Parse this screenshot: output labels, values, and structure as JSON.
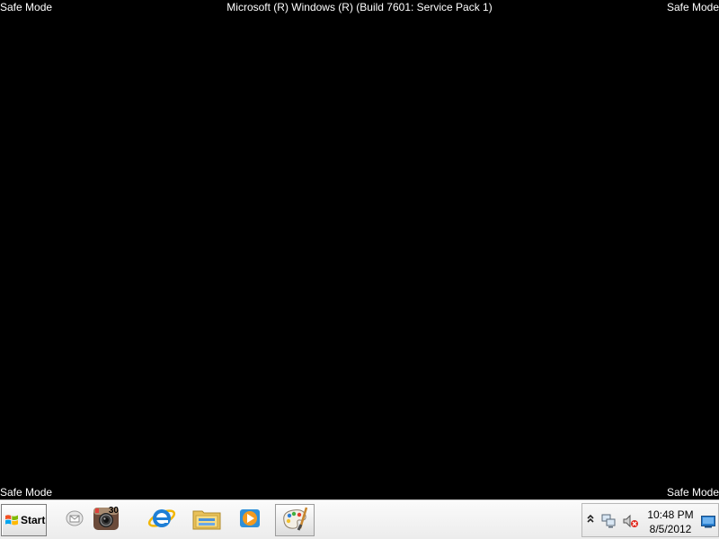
{
  "screen": {
    "mode_label": "Safe Mode",
    "os_banner": "Microsoft (R) Windows (R) (Build 7601: Service Pack 1)"
  },
  "taskbar": {
    "start_label": "Start",
    "pinned": [
      {
        "icon": "mail-icon"
      },
      {
        "icon": "camera-app-icon",
        "badge": "30"
      },
      {
        "icon": "internet-explorer-icon"
      },
      {
        "icon": "windows-explorer-icon"
      },
      {
        "icon": "media-player-icon"
      },
      {
        "icon": "paint-icon"
      }
    ]
  },
  "tray": {
    "time": "10:48 PM",
    "date": "8/5/2012",
    "icons": [
      "chevron-up-icon",
      "network-icon",
      "volume-muted-icon",
      "show-desktop-icon"
    ]
  },
  "colors": {
    "desktop_bg": "#000000",
    "watermark_text": "#ffffff",
    "taskbar_bg": "#f0f0f0"
  }
}
